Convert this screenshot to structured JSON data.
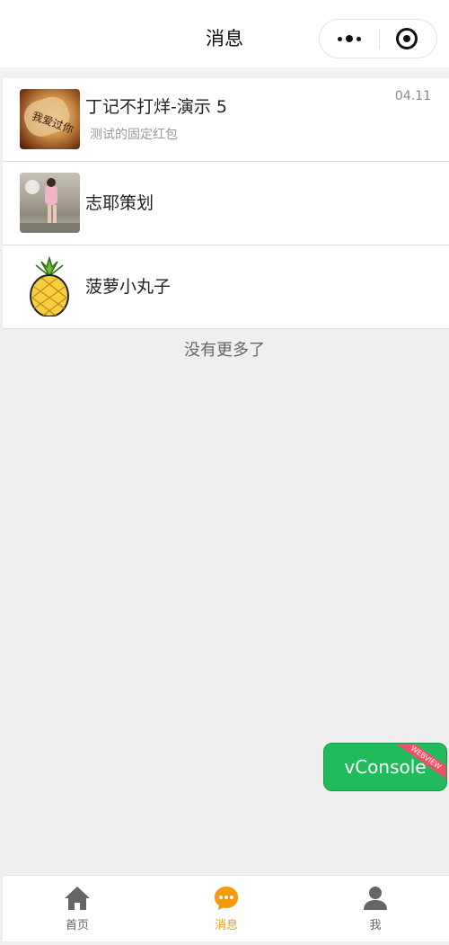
{
  "header": {
    "title": "消息",
    "more_icon": "more-dots-icon",
    "close_icon": "target-close-icon"
  },
  "list": [
    {
      "name": "丁记不打烊-演示 5",
      "subtitle": "测试的固定红包",
      "time": "04.11",
      "avatar_icon": "photo-avatar-icon"
    },
    {
      "name": "志耶策划",
      "subtitle": "",
      "time": "",
      "avatar_icon": "photo-avatar-icon"
    },
    {
      "name": "菠萝小丸子",
      "subtitle": "",
      "time": "",
      "avatar_icon": "pineapple-avatar-icon"
    }
  ],
  "footer_note": "没有更多了",
  "vconsole": {
    "label": "vConsole",
    "ribbon": "WEBVIEW"
  },
  "tabbar": {
    "items": [
      {
        "label": "首页",
        "icon": "home-icon",
        "active": false
      },
      {
        "label": "消息",
        "icon": "message-icon",
        "active": true
      },
      {
        "label": "我",
        "icon": "person-icon",
        "active": false
      }
    ]
  },
  "colors": {
    "accent": "#f59a0b",
    "vconsole": "#22bb5c",
    "ribbon": "#f04f68"
  }
}
